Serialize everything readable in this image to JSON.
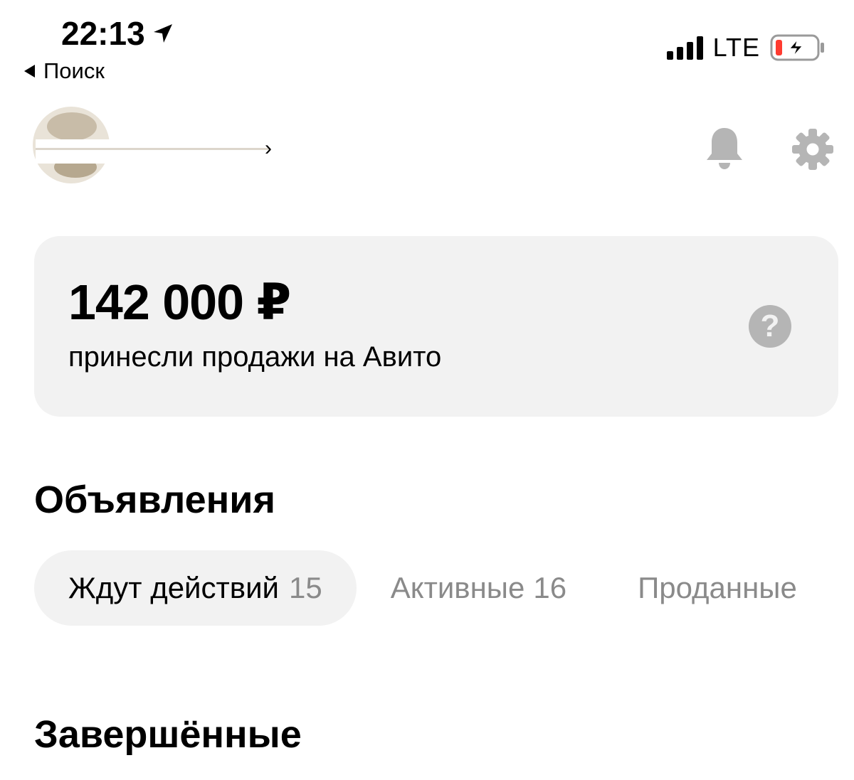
{
  "status_bar": {
    "time": "22:13",
    "back_label": "Поиск",
    "network": "LTE"
  },
  "profile": {
    "avatar_icon": "avatar",
    "notifications_icon": "bell-icon",
    "settings_icon": "gear-icon"
  },
  "earnings": {
    "amount": "142 000 ₽",
    "caption": "принесли продажи на Авито",
    "help_glyph": "?"
  },
  "listings": {
    "title": "Объявления",
    "tabs": [
      {
        "label": "Ждут действий",
        "count": "15",
        "active": true
      },
      {
        "label": "Активные",
        "count": "16",
        "active": false
      },
      {
        "label": "Проданные",
        "count": "",
        "active": false
      }
    ]
  },
  "completed": {
    "title": "Завершённые"
  },
  "colors": {
    "card_bg": "#f2f2f2",
    "muted_text": "#8a8a8a",
    "icon_gray": "#b5b5b5",
    "battery_low": "#ff3b30"
  }
}
